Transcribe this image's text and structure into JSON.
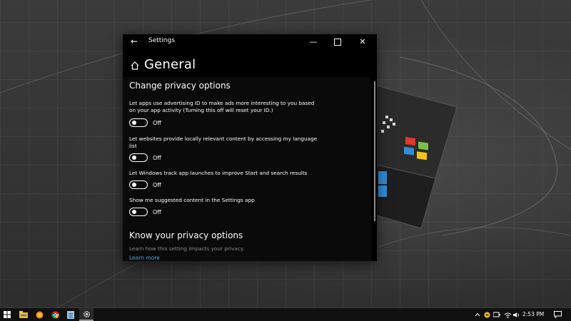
{
  "window": {
    "title": "Settings",
    "back_icon": "back-arrow-icon",
    "min_glyph": "—",
    "close_glyph": "✕"
  },
  "header": {
    "home_icon": "home-icon",
    "title": "General"
  },
  "sections": {
    "change": {
      "heading": "Change privacy options",
      "items": [
        {
          "label": "Let apps use advertising ID to make ads more interesting to you based on your app activity (Turning this off will reset your ID.)",
          "state": "Off"
        },
        {
          "label": "Let websites provide locally relevant content by accessing my language list",
          "state": "Off"
        },
        {
          "label": "Let Windows track app launches to improve Start and search results",
          "state": "Off"
        },
        {
          "label": "Show me suggested content in the Settings app",
          "state": "Off"
        }
      ]
    },
    "know": {
      "heading": "Know your privacy options",
      "desc": "Learn how this setting impacts your privacy.",
      "link": "Learn more"
    }
  },
  "taskbar": {
    "apps": [
      "windows-start-icon",
      "file-explorer-icon",
      "firefox-icon",
      "chrome-icon",
      "notepad-icon",
      "settings-gear-icon"
    ],
    "tray_icons": [
      "chevron-up-icon",
      "battery-icon",
      "network-icon",
      "wifi-icon",
      "volume-icon"
    ],
    "time": "2:53 PM",
    "notification_icon": "notification-icon"
  },
  "colors": {
    "window_bg": "#000000",
    "accent_link": "#4aa3e6",
    "muted_text": "#8a8a8a"
  }
}
